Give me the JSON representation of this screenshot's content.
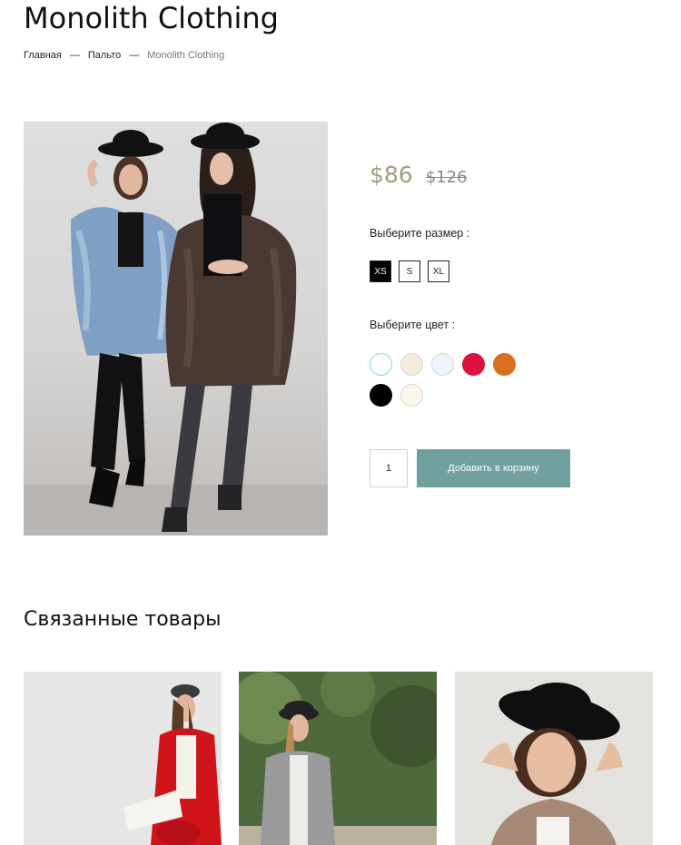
{
  "product": {
    "title": "Monolith Clothing",
    "price": "$86",
    "old_price": "$126"
  },
  "breadcrumb": {
    "home": "Главная",
    "category": "Пальто",
    "current": "Monolith Clothing",
    "separator": "—"
  },
  "size": {
    "label": "Выберите размер :",
    "options": [
      "XS",
      "S",
      "XL"
    ],
    "selected": "XS"
  },
  "color": {
    "label": "Выберите цвет :",
    "options": [
      {
        "name": "light-cyan",
        "hex": "#ffffff",
        "border": "#7fd8e2"
      },
      {
        "name": "cream",
        "hex": "#f6ead9"
      },
      {
        "name": "pale-blue",
        "hex": "#eef4fb"
      },
      {
        "name": "crimson",
        "hex": "#dc1340"
      },
      {
        "name": "orange",
        "hex": "#d9701f"
      },
      {
        "name": "black",
        "hex": "#000000"
      },
      {
        "name": "ivory",
        "hex": "#fbf6e8"
      }
    ]
  },
  "cart": {
    "quantity": "1",
    "add_label": "Добавить в корзину",
    "button_color": "#6fa09e"
  },
  "related": {
    "title": "Связанные товары"
  }
}
